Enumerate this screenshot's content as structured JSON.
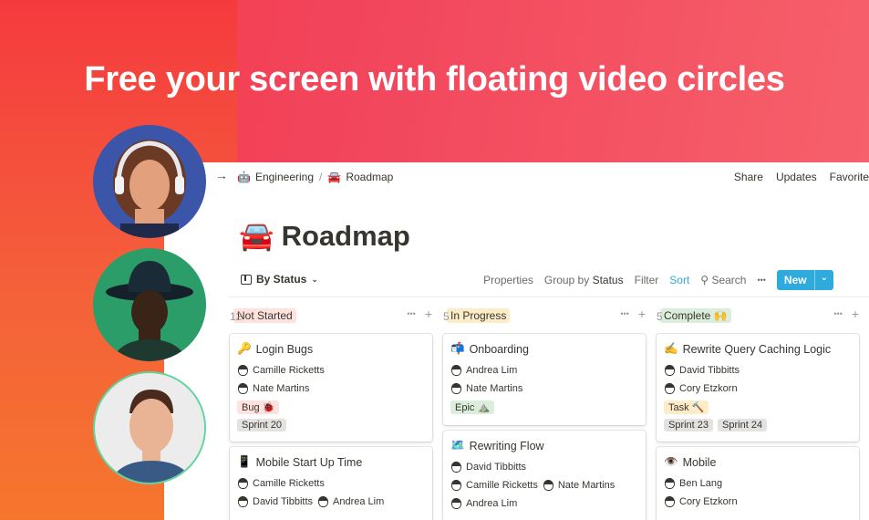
{
  "headline": "Free your screen with floating video circles",
  "breadcrumb": {
    "items": [
      {
        "icon": "🤖",
        "label": "Engineering"
      },
      {
        "icon": "🚘",
        "label": "Roadmap"
      }
    ],
    "separator": "/"
  },
  "top_actions": {
    "share": "Share",
    "updates": "Updates",
    "favorite": "Favorite"
  },
  "page": {
    "icon": "🚘",
    "title": "Roadmap"
  },
  "toolbar": {
    "view": "By Status",
    "properties": "Properties",
    "group_prefix": "Group by",
    "group_value": "Status",
    "filter": "Filter",
    "sort": "Sort",
    "search": "Search",
    "more": "•••",
    "new": "New"
  },
  "columns": [
    {
      "label": "Not Started",
      "count": "12",
      "color": "#ffe2dd",
      "cards": [
        {
          "icon": "🔑",
          "title": "Login Bugs",
          "people": [
            [
              "Camille Ricketts"
            ],
            [
              "Nate Martins"
            ]
          ],
          "tags": [
            "Bug 🐞"
          ],
          "tags2": [
            "Sprint 20"
          ]
        },
        {
          "icon": "📱",
          "title": "Mobile Start Up Time",
          "people": [
            [
              "Camille Ricketts"
            ],
            [
              "David Tibbitts",
              "Andrea Lim"
            ]
          ],
          "tags": [],
          "tags2": []
        }
      ]
    },
    {
      "label": "In Progress",
      "count": "5",
      "color": "#fdecc8",
      "cards": [
        {
          "icon": "📬",
          "title": "Onboarding",
          "people": [
            [
              "Andrea Lim"
            ],
            [
              "Nate Martins"
            ]
          ],
          "tags": [
            "Epic ⛰️"
          ],
          "tags2": []
        },
        {
          "icon": "🗺️",
          "title": "Rewriting Flow",
          "people": [
            [
              "David Tibbitts"
            ],
            [
              "Camille Ricketts",
              "Nate Martins"
            ],
            [
              "Andrea Lim"
            ]
          ],
          "tags": [],
          "tags2": []
        }
      ]
    },
    {
      "label": "Complete 🙌",
      "count": "5",
      "color": "#dbeddb",
      "cards": [
        {
          "icon": "✍️",
          "title": "Rewrite Query Caching Logic",
          "people": [
            [
              "David Tibbitts"
            ],
            [
              "Cory Etzkorn"
            ]
          ],
          "tags": [
            "Task 🔨"
          ],
          "tags2": [
            "Sprint 23",
            "Sprint 24"
          ]
        },
        {
          "icon": "👁️",
          "title": "Mobile",
          "people": [
            [
              "Ben Lang"
            ],
            [
              "Cory Etzkorn"
            ]
          ],
          "tags": [],
          "tags2": []
        }
      ]
    }
  ],
  "colors": {
    "accent": "#2eaadc",
    "background": "#f2435a",
    "bug_tag": "#ffe2dd",
    "epic_tag": "#dbeddb",
    "task_tag": "#fdecc8",
    "sprint_tag": "#e3e2e0"
  }
}
